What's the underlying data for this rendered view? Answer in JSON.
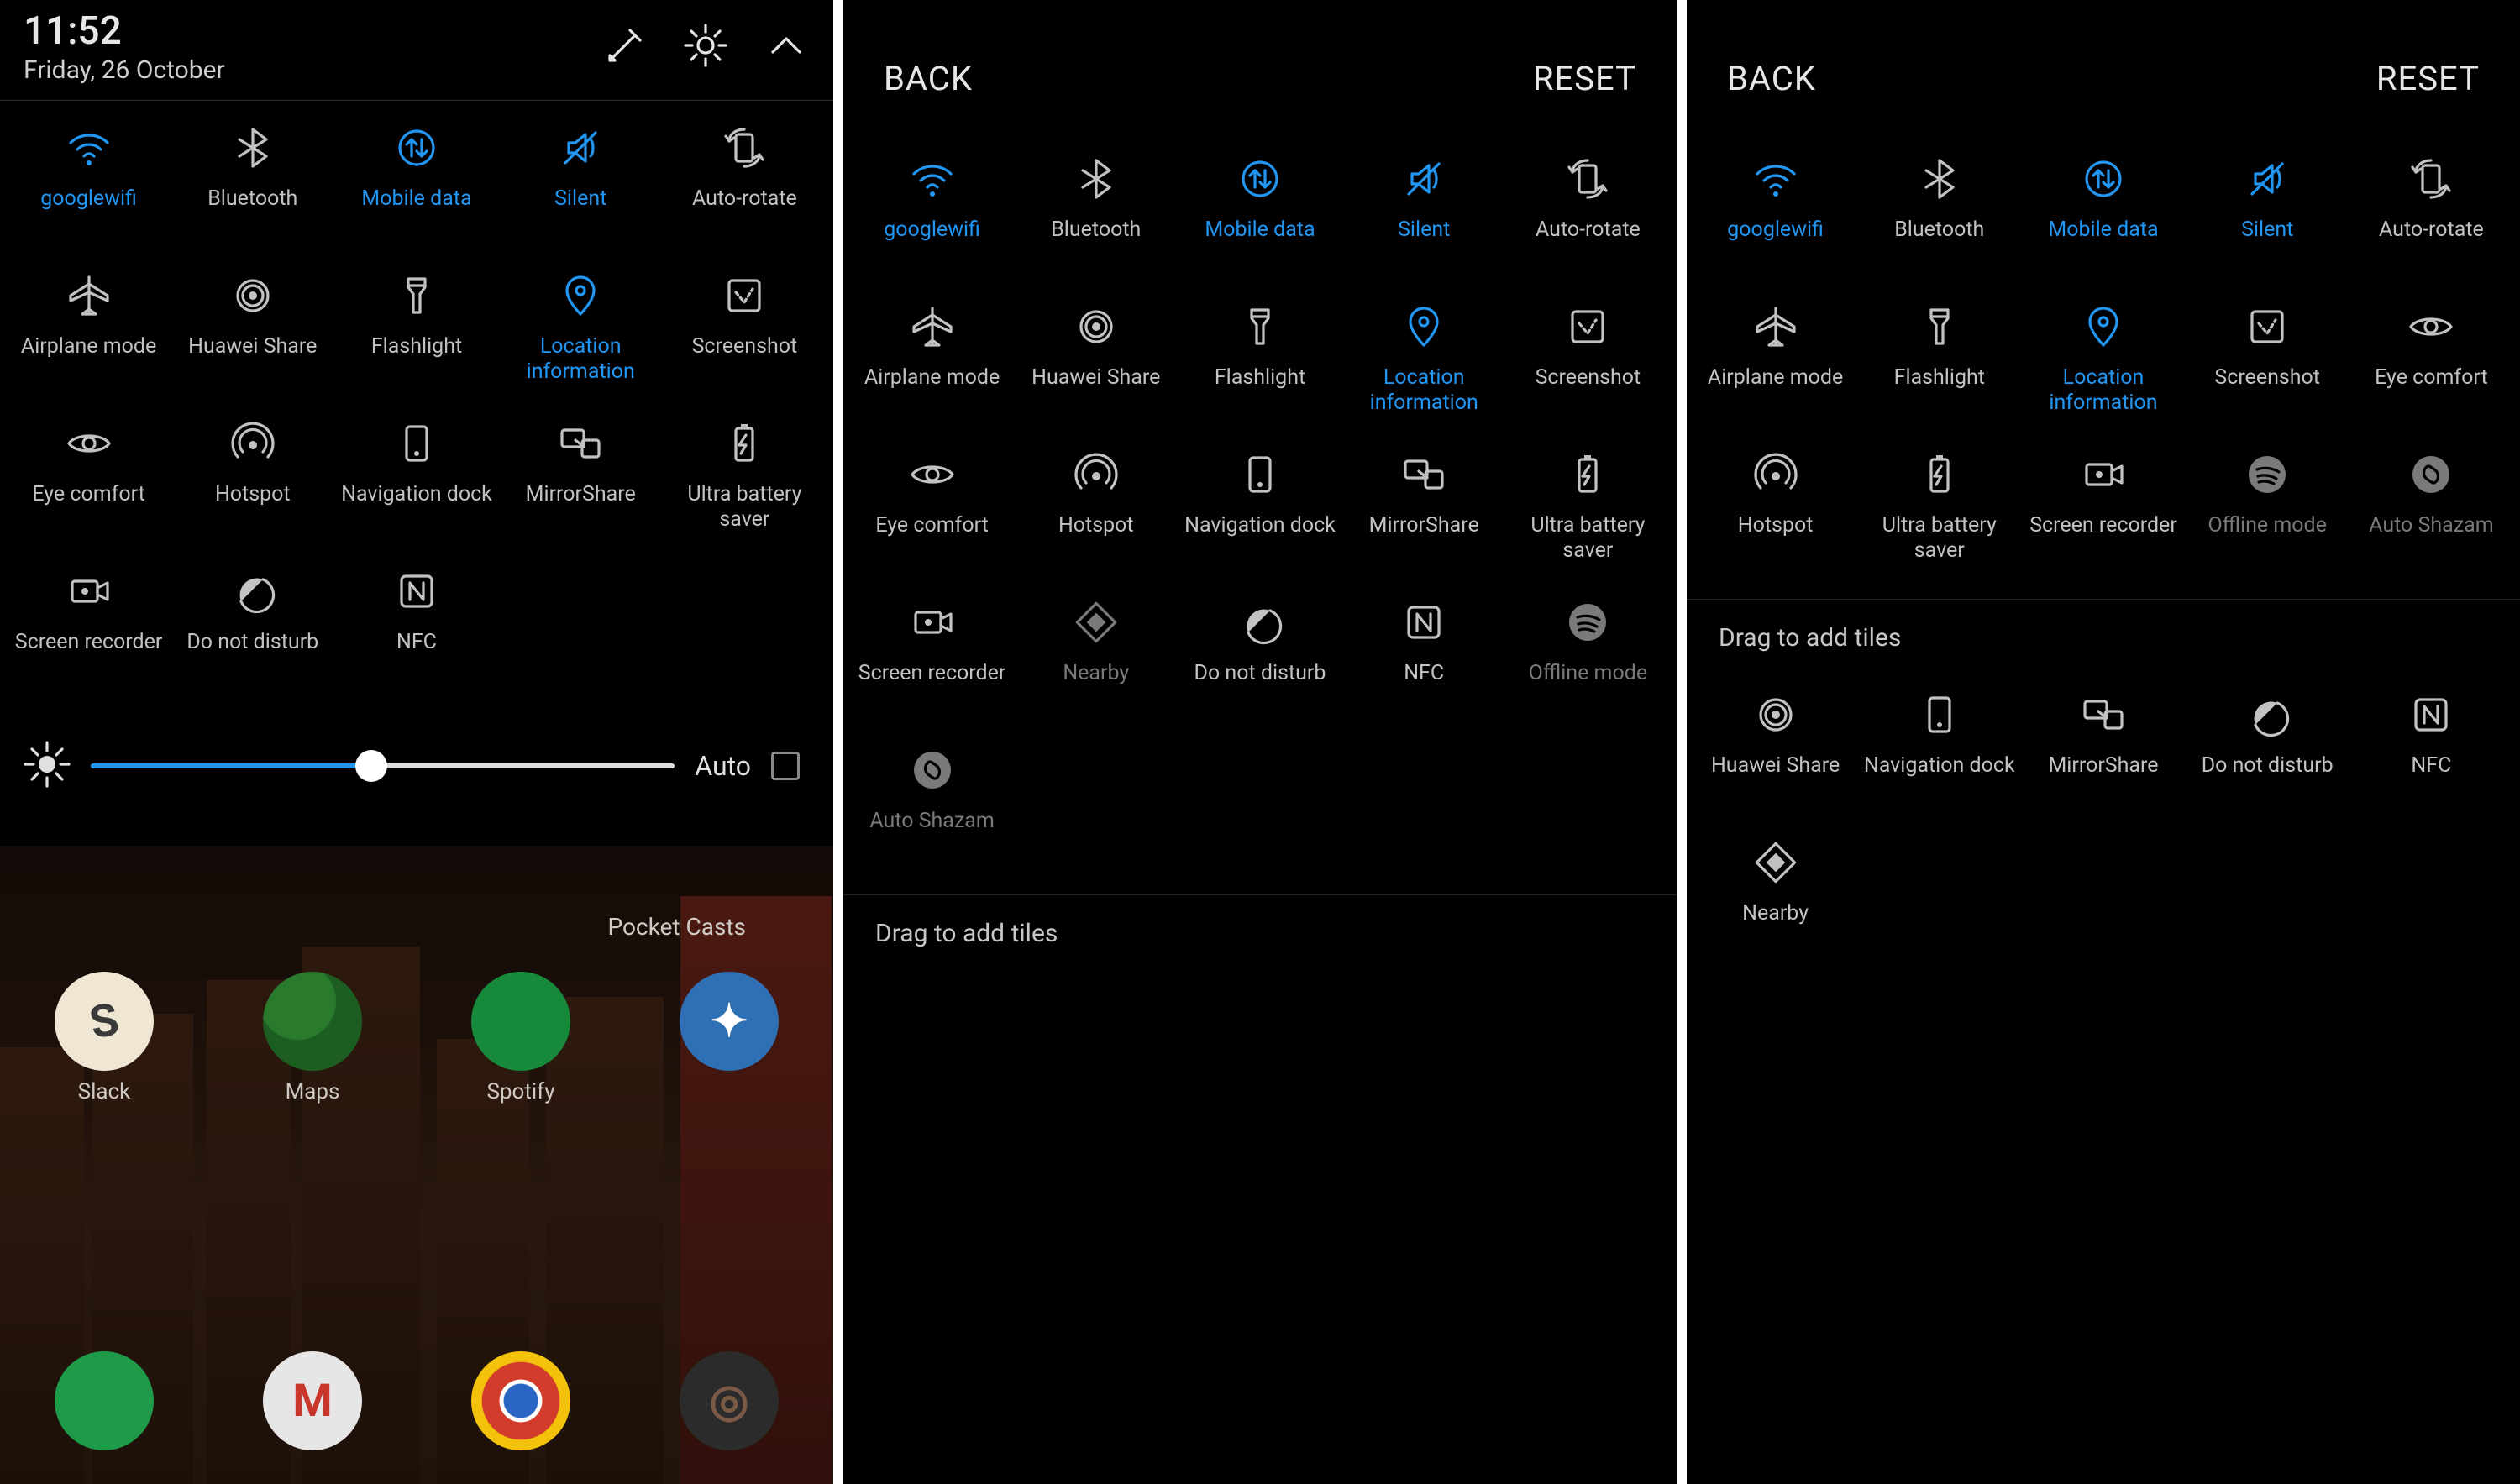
{
  "screen1": {
    "time": "11:52",
    "date": "Friday, 26 October",
    "tiles": [
      {
        "label": "googlewifi",
        "icon": "wifi",
        "state": "active"
      },
      {
        "label": "Bluetooth",
        "icon": "bluetooth",
        "state": "inactive"
      },
      {
        "label": "Mobile data",
        "icon": "mobiledata",
        "state": "active"
      },
      {
        "label": "Silent",
        "icon": "silent",
        "state": "active"
      },
      {
        "label": "Auto-rotate",
        "icon": "autorotate",
        "state": "inactive"
      },
      {
        "label": "Airplane mode",
        "icon": "airplane",
        "state": "inactive"
      },
      {
        "label": "Huawei Share",
        "icon": "huaweishare",
        "state": "inactive"
      },
      {
        "label": "Flashlight",
        "icon": "flashlight",
        "state": "inactive"
      },
      {
        "label": "Location information",
        "icon": "location",
        "state": "active"
      },
      {
        "label": "Screenshot",
        "icon": "screenshot",
        "state": "inactive"
      },
      {
        "label": "Eye comfort",
        "icon": "eye",
        "state": "inactive"
      },
      {
        "label": "Hotspot",
        "icon": "hotspot",
        "state": "inactive"
      },
      {
        "label": "Navigation dock",
        "icon": "navdock",
        "state": "inactive"
      },
      {
        "label": "MirrorShare",
        "icon": "mirrorshare",
        "state": "inactive"
      },
      {
        "label": "Ultra battery saver",
        "icon": "battery",
        "state": "inactive"
      },
      {
        "label": "Screen recorder",
        "icon": "screenrec",
        "state": "inactive"
      },
      {
        "label": "Do not disturb",
        "icon": "dnd",
        "state": "inactive"
      },
      {
        "label": "NFC",
        "icon": "nfc",
        "state": "inactive"
      }
    ],
    "brightness": {
      "percent": 48,
      "auto_label": "Auto",
      "auto_checked": false
    },
    "home": {
      "widget_label": "Pocket Casts",
      "row1": [
        {
          "label": "Slack",
          "cls": "slack",
          "txt": "S"
        },
        {
          "label": "Maps",
          "cls": "maps",
          "txt": ""
        },
        {
          "label": "Spotify",
          "cls": "spot",
          "txt": ""
        },
        {
          "label": "",
          "cls": "rocket",
          "txt": "✦"
        }
      ],
      "row2": [
        {
          "label": "",
          "cls": "wa",
          "txt": ""
        },
        {
          "label": "",
          "cls": "gm",
          "txt": "M"
        },
        {
          "label": "",
          "cls": "chrome",
          "txt": ""
        },
        {
          "label": "",
          "cls": "last",
          "txt": "◎"
        }
      ]
    }
  },
  "screen2": {
    "back": "BACK",
    "reset": "RESET",
    "tiles": [
      {
        "label": "googlewifi",
        "icon": "wifi",
        "state": "active"
      },
      {
        "label": "Bluetooth",
        "icon": "bluetooth",
        "state": "inactive"
      },
      {
        "label": "Mobile data",
        "icon": "mobiledata",
        "state": "active"
      },
      {
        "label": "Silent",
        "icon": "silent",
        "state": "active"
      },
      {
        "label": "Auto-rotate",
        "icon": "autorotate",
        "state": "inactive"
      },
      {
        "label": "Airplane mode",
        "icon": "airplane",
        "state": "inactive"
      },
      {
        "label": "Huawei Share",
        "icon": "huaweishare",
        "state": "inactive"
      },
      {
        "label": "Flashlight",
        "icon": "flashlight",
        "state": "inactive"
      },
      {
        "label": "Location information",
        "icon": "location",
        "state": "active"
      },
      {
        "label": "Screenshot",
        "icon": "screenshot",
        "state": "inactive"
      },
      {
        "label": "Eye comfort",
        "icon": "eye",
        "state": "inactive"
      },
      {
        "label": "Hotspot",
        "icon": "hotspot",
        "state": "inactive"
      },
      {
        "label": "Navigation dock",
        "icon": "navdock",
        "state": "inactive"
      },
      {
        "label": "MirrorShare",
        "icon": "mirrorshare",
        "state": "inactive"
      },
      {
        "label": "Ultra battery saver",
        "icon": "battery",
        "state": "inactive"
      },
      {
        "label": "Screen recorder",
        "icon": "screenrec",
        "state": "inactive"
      },
      {
        "label": "Nearby",
        "icon": "nearby",
        "state": "ghost"
      },
      {
        "label": "Do not disturb",
        "icon": "dnd",
        "state": "inactive"
      },
      {
        "label": "NFC",
        "icon": "nfc",
        "state": "inactive"
      },
      {
        "label": "Offline mode",
        "icon": "spotify",
        "state": "ghost"
      },
      {
        "label": "Auto Shazam",
        "icon": "shazam",
        "state": "ghost"
      }
    ],
    "drag_label": "Drag to add tiles"
  },
  "screen3": {
    "back": "BACK",
    "reset": "RESET",
    "tiles": [
      {
        "label": "googlewifi",
        "icon": "wifi",
        "state": "active"
      },
      {
        "label": "Bluetooth",
        "icon": "bluetooth",
        "state": "inactive"
      },
      {
        "label": "Mobile data",
        "icon": "mobiledata",
        "state": "active"
      },
      {
        "label": "Silent",
        "icon": "silent",
        "state": "active"
      },
      {
        "label": "Auto-rotate",
        "icon": "autorotate",
        "state": "inactive"
      },
      {
        "label": "Airplane mode",
        "icon": "airplane",
        "state": "inactive"
      },
      {
        "label": "Flashlight",
        "icon": "flashlight",
        "state": "inactive"
      },
      {
        "label": "Location information",
        "icon": "location",
        "state": "active"
      },
      {
        "label": "Screenshot",
        "icon": "screenshot",
        "state": "inactive"
      },
      {
        "label": "Eye comfort",
        "icon": "eye",
        "state": "inactive"
      },
      {
        "label": "Hotspot",
        "icon": "hotspot",
        "state": "inactive"
      },
      {
        "label": "Ultra battery saver",
        "icon": "battery",
        "state": "inactive"
      },
      {
        "label": "Screen recorder",
        "icon": "screenrec",
        "state": "inactive"
      },
      {
        "label": "Offline mode",
        "icon": "spotify",
        "state": "ghost"
      },
      {
        "label": "Auto Shazam",
        "icon": "shazam",
        "state": "ghost"
      }
    ],
    "drag_label": "Drag to add tiles",
    "extra_tiles": [
      {
        "label": "Huawei Share",
        "icon": "huaweishare",
        "state": "inactive"
      },
      {
        "label": "Navigation dock",
        "icon": "navdock",
        "state": "inactive"
      },
      {
        "label": "MirrorShare",
        "icon": "mirrorshare",
        "state": "inactive"
      },
      {
        "label": "Do not disturb",
        "icon": "dnd",
        "state": "inactive"
      },
      {
        "label": "NFC",
        "icon": "nfc",
        "state": "inactive"
      },
      {
        "label": "Nearby",
        "icon": "nearby",
        "state": "inactive"
      }
    ]
  }
}
